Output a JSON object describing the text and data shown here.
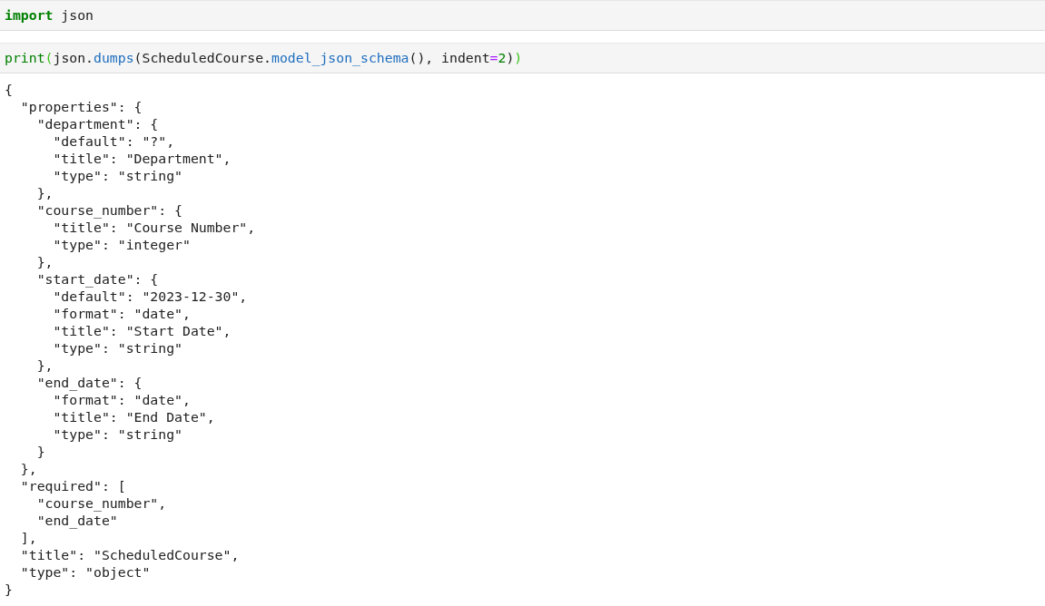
{
  "cells": [
    {
      "input": [
        [
          {
            "kind": "keyword",
            "text": "import"
          },
          {
            "kind": "plain",
            "text": " json"
          }
        ]
      ]
    },
    {
      "input": [
        [
          {
            "kind": "builtin",
            "text": "print"
          },
          {
            "kind": "paren",
            "text": "("
          },
          {
            "kind": "plain",
            "text": "json."
          },
          {
            "kind": "function",
            "text": "dumps"
          },
          {
            "kind": "plain",
            "text": "(ScheduledCourse."
          },
          {
            "kind": "function",
            "text": "model_json_schema"
          },
          {
            "kind": "plain",
            "text": "(), indent"
          },
          {
            "kind": "operator",
            "text": "="
          },
          {
            "kind": "number",
            "text": "2"
          },
          {
            "kind": "plain",
            "text": ")"
          },
          {
            "kind": "paren",
            "text": ")"
          }
        ]
      ],
      "output": [
        "{",
        "  \"properties\": {",
        "    \"department\": {",
        "      \"default\": \"?\",",
        "      \"title\": \"Department\",",
        "      \"type\": \"string\"",
        "    },",
        "    \"course_number\": {",
        "      \"title\": \"Course Number\",",
        "      \"type\": \"integer\"",
        "    },",
        "    \"start_date\": {",
        "      \"default\": \"2023-12-30\",",
        "      \"format\": \"date\",",
        "      \"title\": \"Start Date\",",
        "      \"type\": \"string\"",
        "    },",
        "    \"end_date\": {",
        "      \"format\": \"date\",",
        "      \"title\": \"End Date\",",
        "      \"type\": \"string\"",
        "    }",
        "  },",
        "  \"required\": [",
        "    \"course_number\",",
        "    \"end_date\"",
        "  ],",
        "  \"title\": \"ScheduledCourse\",",
        "  \"type\": \"object\"",
        "}"
      ]
    }
  ]
}
